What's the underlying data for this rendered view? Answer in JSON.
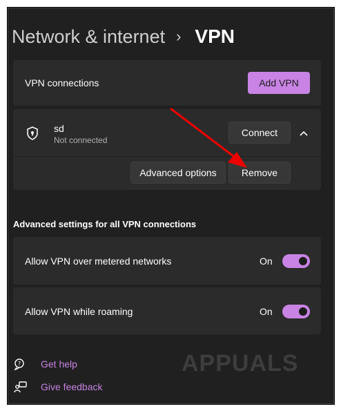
{
  "header": {
    "section": "Network & internet",
    "separator": "›",
    "page": "VPN"
  },
  "vpn": {
    "label": "VPN connections",
    "add_button": "Add VPN",
    "connection": {
      "name": "sd",
      "status": "Not connected",
      "connect_button": "Connect",
      "advanced_button": "Advanced options",
      "remove_button": "Remove"
    }
  },
  "advanced": {
    "heading": "Advanced settings for all VPN connections",
    "settings": [
      {
        "label": "Allow VPN over metered networks",
        "state": "On",
        "enabled": true
      },
      {
        "label": "Allow VPN while roaming",
        "state": "On",
        "enabled": true
      }
    ]
  },
  "links": {
    "help": "Get help",
    "feedback": "Give feedback"
  },
  "watermark": {
    "text": "APPUALS"
  },
  "colors": {
    "accent": "#c883e4",
    "background": "#202020",
    "card": "#2b2b2b",
    "arrow": "#ee0000"
  },
  "icons": [
    "shield-lock-icon",
    "chevron-up-icon",
    "help-icon",
    "feedback-icon"
  ]
}
